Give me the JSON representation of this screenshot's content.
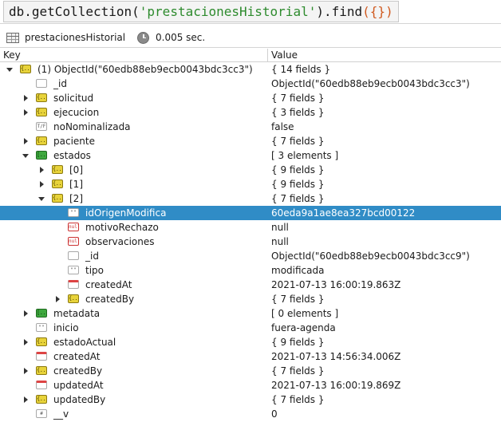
{
  "query": {
    "db": "db",
    "dot1": ".",
    "fn1": "getCollection",
    "open1": "(",
    "collection": "'prestacionesHistorial'",
    "close1": ")",
    "dot2": ".",
    "fn2": "find",
    "open2": "(",
    "braces": "{}",
    "close2": ")"
  },
  "info": {
    "collection": "prestacionesHistorial",
    "time": "0.005 sec."
  },
  "columns": {
    "key": "Key",
    "value": "Value"
  },
  "rows": [
    {
      "key": "(1) ObjectId(\"60edb88eb9ecb0043bdc3cc3\")",
      "value": "{ 14 fields }"
    },
    {
      "key": "_id",
      "value": "ObjectId(\"60edb88eb9ecb0043bdc3cc3\")"
    },
    {
      "key": "solicitud",
      "value": "{ 7 fields }"
    },
    {
      "key": "ejecucion",
      "value": "{ 3 fields }"
    },
    {
      "key": "noNominalizada",
      "value": "false"
    },
    {
      "key": "paciente",
      "value": "{ 7 fields }"
    },
    {
      "key": "estados",
      "value": "[ 3 elements ]"
    },
    {
      "key": "[0]",
      "value": "{ 9 fields }"
    },
    {
      "key": "[1]",
      "value": "{ 9 fields }"
    },
    {
      "key": "[2]",
      "value": "{ 7 fields }"
    },
    {
      "key": "idOrigenModifica",
      "value": "60eda9a1ae8ea327bcd00122"
    },
    {
      "key": "motivoRechazo",
      "value": "null"
    },
    {
      "key": "observaciones",
      "value": "null"
    },
    {
      "key": "_id",
      "value": "ObjectId(\"60edb88eb9ecb0043bdc3cc9\")"
    },
    {
      "key": "tipo",
      "value": "modificada"
    },
    {
      "key": "createdAt",
      "value": "2021-07-13 16:00:19.863Z"
    },
    {
      "key": "createdBy",
      "value": "{ 7 fields }"
    },
    {
      "key": "metadata",
      "value": "[ 0 elements ]"
    },
    {
      "key": "inicio",
      "value": "fuera-agenda"
    },
    {
      "key": "estadoActual",
      "value": "{ 9 fields }"
    },
    {
      "key": "createdAt",
      "value": "2021-07-13 14:56:34.006Z"
    },
    {
      "key": "createdBy",
      "value": "{ 7 fields }"
    },
    {
      "key": "updatedAt",
      "value": "2021-07-13 16:00:19.869Z"
    },
    {
      "key": "updatedBy",
      "value": "{ 7 fields }"
    },
    {
      "key": "__v",
      "value": "0"
    }
  ],
  "icon_labels": {
    "bool": "T/F",
    "str": "\"\"",
    "null": "null",
    "num": "#"
  },
  "colors": {
    "selection": "#308cc6",
    "string_literal": "#2e8b2e",
    "brace": "#d05a20"
  }
}
